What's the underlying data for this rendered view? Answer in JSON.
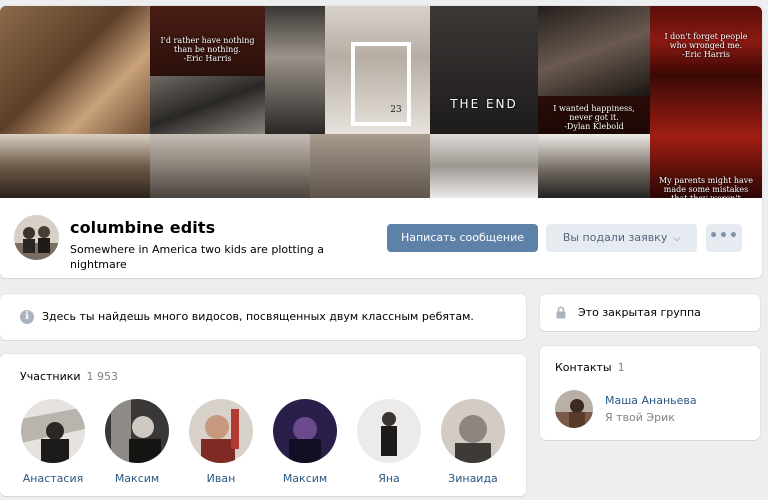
{
  "group": {
    "name": "columbine edits",
    "status": "Somewhere in America two kids are plotting a nightmare"
  },
  "cover": {
    "captions": {
      "quote_1": "I'd rather have nothing\nthan be nothing.\n-Eric Harris",
      "number": "2‌3",
      "the_end": "THE END",
      "quote_2": "I wanted happiness,\nnever got it.\n-Dylan Klebold",
      "quote_3": "I don't forget people\nwho wronged me.\n-Eric Harris",
      "quote_4": "My parents might have\nmade some mistakes\nthat they weren't"
    }
  },
  "actions": {
    "message_button": "Написать сообщение",
    "request_button": "Вы подали заявку",
    "more_button": "•••"
  },
  "info": {
    "text": "Здесь ты найдешь много видосов, посвященных двум классным ребятам."
  },
  "closed": {
    "text": "Это закрытая группа"
  },
  "members": {
    "title": "Участники",
    "count": "1 953",
    "items": [
      {
        "name": "Анастасия"
      },
      {
        "name": "Максим"
      },
      {
        "name": "Иван"
      },
      {
        "name": "Максим"
      },
      {
        "name": "Яна"
      },
      {
        "name": "Зинаида"
      }
    ]
  },
  "contacts": {
    "title": "Контакты",
    "count": "1",
    "items": [
      {
        "name": "Маша Ананьева",
        "role": "Я твой Эрик"
      }
    ]
  },
  "colors": {
    "primary_button": "#5e81a8",
    "secondary_button": "#e5ebf1",
    "link": "#2a5885",
    "page_bg": "#edeef0"
  }
}
